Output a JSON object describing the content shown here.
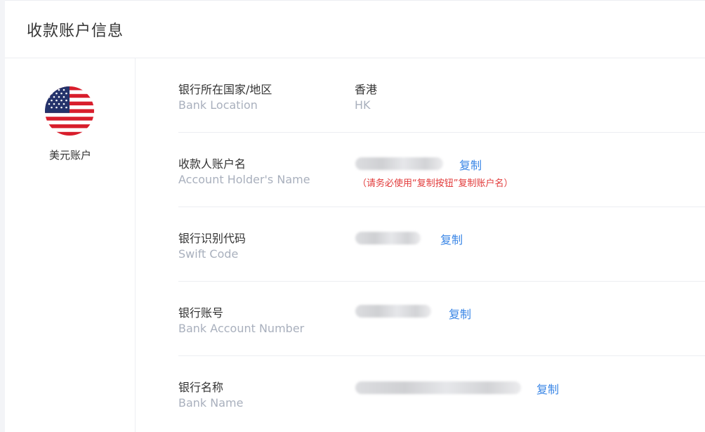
{
  "header": {
    "title": "收款账户信息"
  },
  "account": {
    "flag_icon": "us-flag-icon",
    "type_label": "美元账户"
  },
  "rows": [
    {
      "label_cn": "银行所在国家/地区",
      "label_en": "Bank Location",
      "value_cn": "香港",
      "value_en": "HK"
    },
    {
      "label_cn": "收款人账户名",
      "label_en": "Account Holder's Name",
      "copy_label": "复制",
      "warning": "（请务必使用“复制按钮”复制账户名）"
    },
    {
      "label_cn": "银行识别代码",
      "label_en": "Swift Code",
      "copy_label": "复制"
    },
    {
      "label_cn": "银行账号",
      "label_en": "Bank Account Number",
      "copy_label": "复制"
    },
    {
      "label_cn": "银行名称",
      "label_en": "Bank Name",
      "copy_label": "复制"
    }
  ],
  "colors": {
    "link": "#3a86e6",
    "warning": "#e23b3b",
    "muted": "#a9b0bd"
  }
}
